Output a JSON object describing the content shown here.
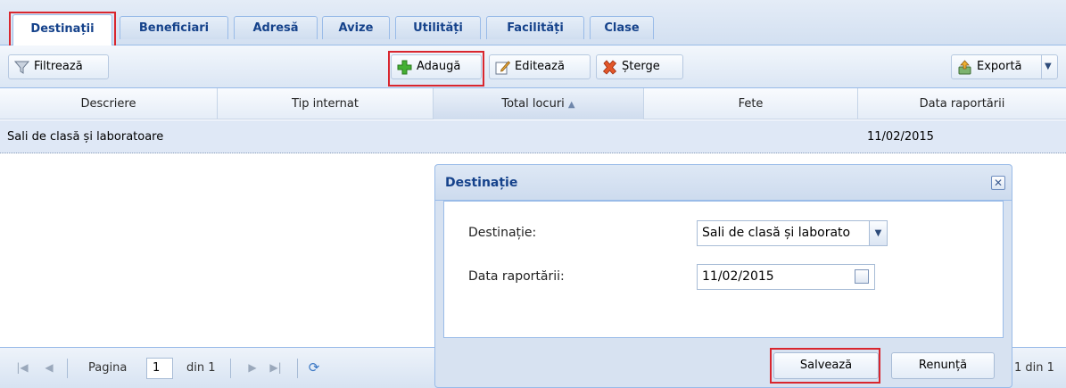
{
  "tabs": [
    {
      "label": "Destinații"
    },
    {
      "label": "Beneficiari"
    },
    {
      "label": "Adresă"
    },
    {
      "label": "Avize"
    },
    {
      "label": "Utilități"
    },
    {
      "label": "Facilități"
    },
    {
      "label": "Clase"
    }
  ],
  "toolbar": {
    "filter_label": "Filtrează",
    "add_label": "Adaugă",
    "edit_label": "Editează",
    "delete_label": "Șterge",
    "export_label": "Exportă"
  },
  "grid": {
    "columns": [
      "Descriere",
      "Tip internat",
      "Total locuri",
      "Fete",
      "Data raportării"
    ],
    "sort_indicator": "▲",
    "rows": [
      {
        "descriere": "Sali de clasă și laboratoare",
        "tip_internat": "",
        "total_locuri": "",
        "fete": "",
        "data_raportarii": "11/02/2015"
      }
    ]
  },
  "pager": {
    "page_label": "Pagina",
    "page_value": "1",
    "of_label": "din 1",
    "summary": "1 din 1"
  },
  "dialog": {
    "title": "Destinație",
    "fields": {
      "destinatie_label": "Destinație:",
      "destinatie_value": "Sali de clasă și laborato",
      "data_label": "Data raportării:",
      "data_value": "11/02/2015"
    },
    "save_label": "Salvează",
    "cancel_label": "Renunță"
  },
  "colors": {
    "accent_title": "#15428b",
    "highlight_box": "#d9262e",
    "border": "#99bbe8"
  }
}
